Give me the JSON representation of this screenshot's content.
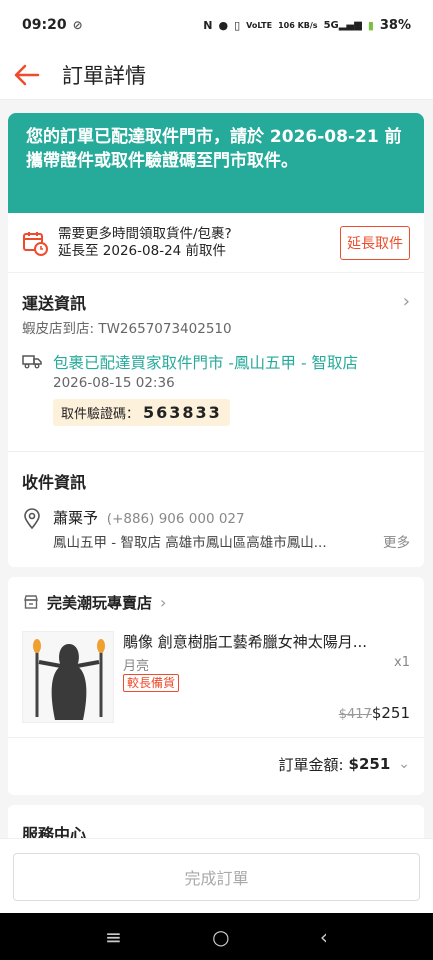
{
  "status_bar": {
    "time": "09:20",
    "battery": "38%",
    "net_speed": "106 KB/s"
  },
  "header": {
    "title": "訂單詳情"
  },
  "banner": {
    "text": "您的訂單已配達取件門市，請於 2026-08-21 前攜帶證件或取件驗證碼至門市取件。"
  },
  "extend": {
    "line1": "需要更多時間領取貨件/包裹?",
    "line2": "延長至 2026-08-24 前取件",
    "button": "延長取件"
  },
  "shipping": {
    "title": "運送資訊",
    "tracking": "蝦皮店到店: TW2657073402510",
    "status": "包裹已配達買家取件門市 -鳳山五甲 - 智取店",
    "time": "2026-08-15 02:36",
    "verify_label": "取件驗證碼：",
    "verify_code": "563833"
  },
  "recipient": {
    "title": "收件資訊",
    "name": "蕭粟予",
    "phone": "(+886) 906 000 027",
    "address": "鳳山五甲 - 智取店 高雄市鳳山區高雄市鳳山...",
    "more": "更多"
  },
  "shop": {
    "name": "完美潮玩專賣店",
    "product": {
      "name": "鵰像 創意樹脂工藝希臘女神太陽月...",
      "variant": "月亮",
      "tag": "較長備貨",
      "qty": "x1",
      "old_price": "$417",
      "price": "$251"
    },
    "total_label": "訂單金額:",
    "total_value": "$251"
  },
  "service": {
    "title": "服務中心"
  },
  "footer": {
    "button": "完成訂單"
  },
  "colors": {
    "accent": "#ee4d2d",
    "banner": "#26aa99",
    "link": "#26aa99"
  }
}
